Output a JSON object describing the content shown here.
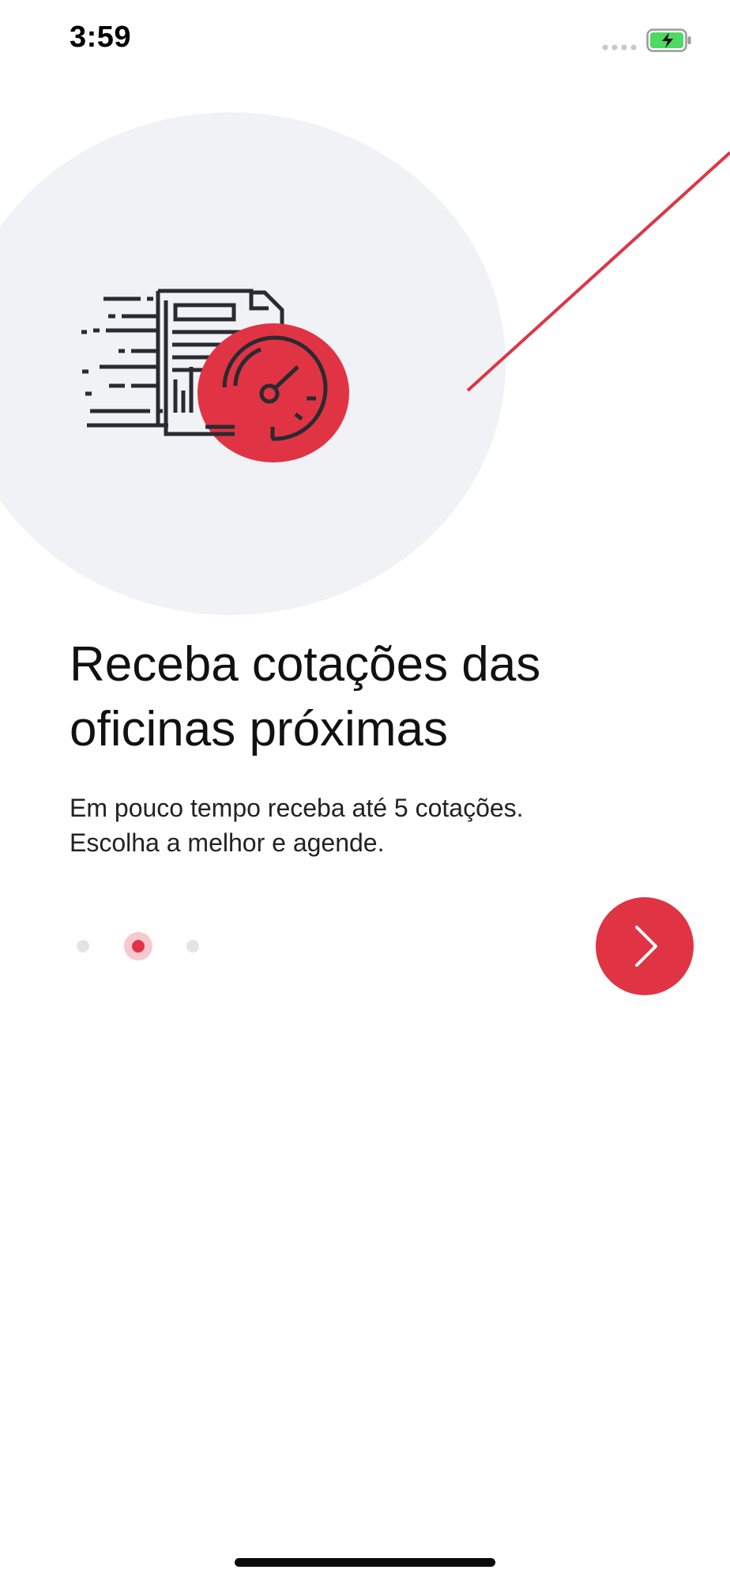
{
  "status_bar": {
    "time": "3:59",
    "signal_icon": "cellular-dots-icon",
    "battery_icon": "battery-charging-icon",
    "battery_color": "#4cd964"
  },
  "hero": {
    "illustration": "document-speedometer-illustration",
    "circle_color": "#f1f2f6",
    "accent_color": "#e03444",
    "line_color": "#1f1f24"
  },
  "onboarding": {
    "title": "Receba cotações das oficinas próximas",
    "subtitle_line1": "Em pouco tempo receba até 5 cotações.",
    "subtitle_line2": "Escolha a melhor e agende."
  },
  "pager": {
    "total_pages": 3,
    "current_page": 2
  },
  "next_button": {
    "icon": "chevron-right-icon",
    "color": "#e03444"
  },
  "home_indicator": {
    "icon": "home-indicator-bar"
  }
}
